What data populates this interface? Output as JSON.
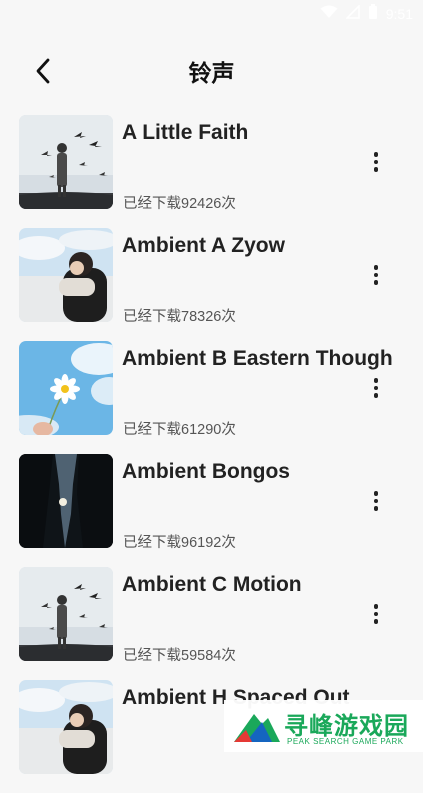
{
  "status": {
    "time": "9:51"
  },
  "header": {
    "title": "铃声"
  },
  "items": [
    {
      "title": "A Little Faith",
      "count": "已经下载92426次",
      "thumb": "birds"
    },
    {
      "title": "Ambient A Zyow",
      "count": "已经下载78326次",
      "thumb": "girl"
    },
    {
      "title": "Ambient B Eastern Though",
      "count": "已经下载61290次",
      "thumb": "flower"
    },
    {
      "title": "Ambient Bongos",
      "count": "已经下载96192次",
      "thumb": "trees"
    },
    {
      "title": "Ambient C Motion",
      "count": "已经下载59584次",
      "thumb": "birds"
    },
    {
      "title": "Ambient H Spaced Out",
      "count": "",
      "thumb": "girl"
    }
  ],
  "watermark": {
    "text": "寻峰游戏园",
    "sub": "PEAK SEARCH GAME PARK"
  }
}
